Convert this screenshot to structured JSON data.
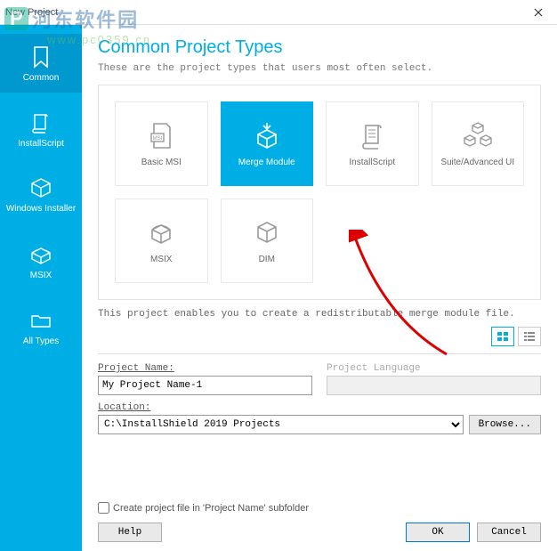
{
  "window": {
    "title": "New Project"
  },
  "watermark": {
    "brand": "河东软件园",
    "url": "www.pc0359.cn"
  },
  "sidebar": {
    "items": [
      {
        "label": "Common",
        "selected": true
      },
      {
        "label": "InstallScript",
        "selected": false
      },
      {
        "label": "Windows Installer",
        "selected": false
      },
      {
        "label": "MSIX",
        "selected": false
      },
      {
        "label": "All Types",
        "selected": false
      }
    ]
  },
  "heading": "Common Project Types",
  "subheading": "These are the project types that users most often select.",
  "tiles": [
    {
      "label": "Basic MSI",
      "selected": false
    },
    {
      "label": "Merge Module",
      "selected": true
    },
    {
      "label": "InstallScript",
      "selected": false
    },
    {
      "label": "Suite/Advanced UI",
      "selected": false
    },
    {
      "label": "MSIX",
      "selected": false
    },
    {
      "label": "DIM",
      "selected": false
    }
  ],
  "desc": "This project enables you to create a redistributable merge module file.",
  "form": {
    "project_name_label": "Project Name:",
    "project_name": "My Project Name-1",
    "project_lang_label": "Project Language",
    "location_label": "Location:",
    "location": "C:\\InstallShield 2019 Projects",
    "browse": "Browse...",
    "subfolder_label": "Create project file in 'Project Name' subfolder"
  },
  "buttons": {
    "help": "Help",
    "ok": "OK",
    "cancel": "Cancel"
  }
}
